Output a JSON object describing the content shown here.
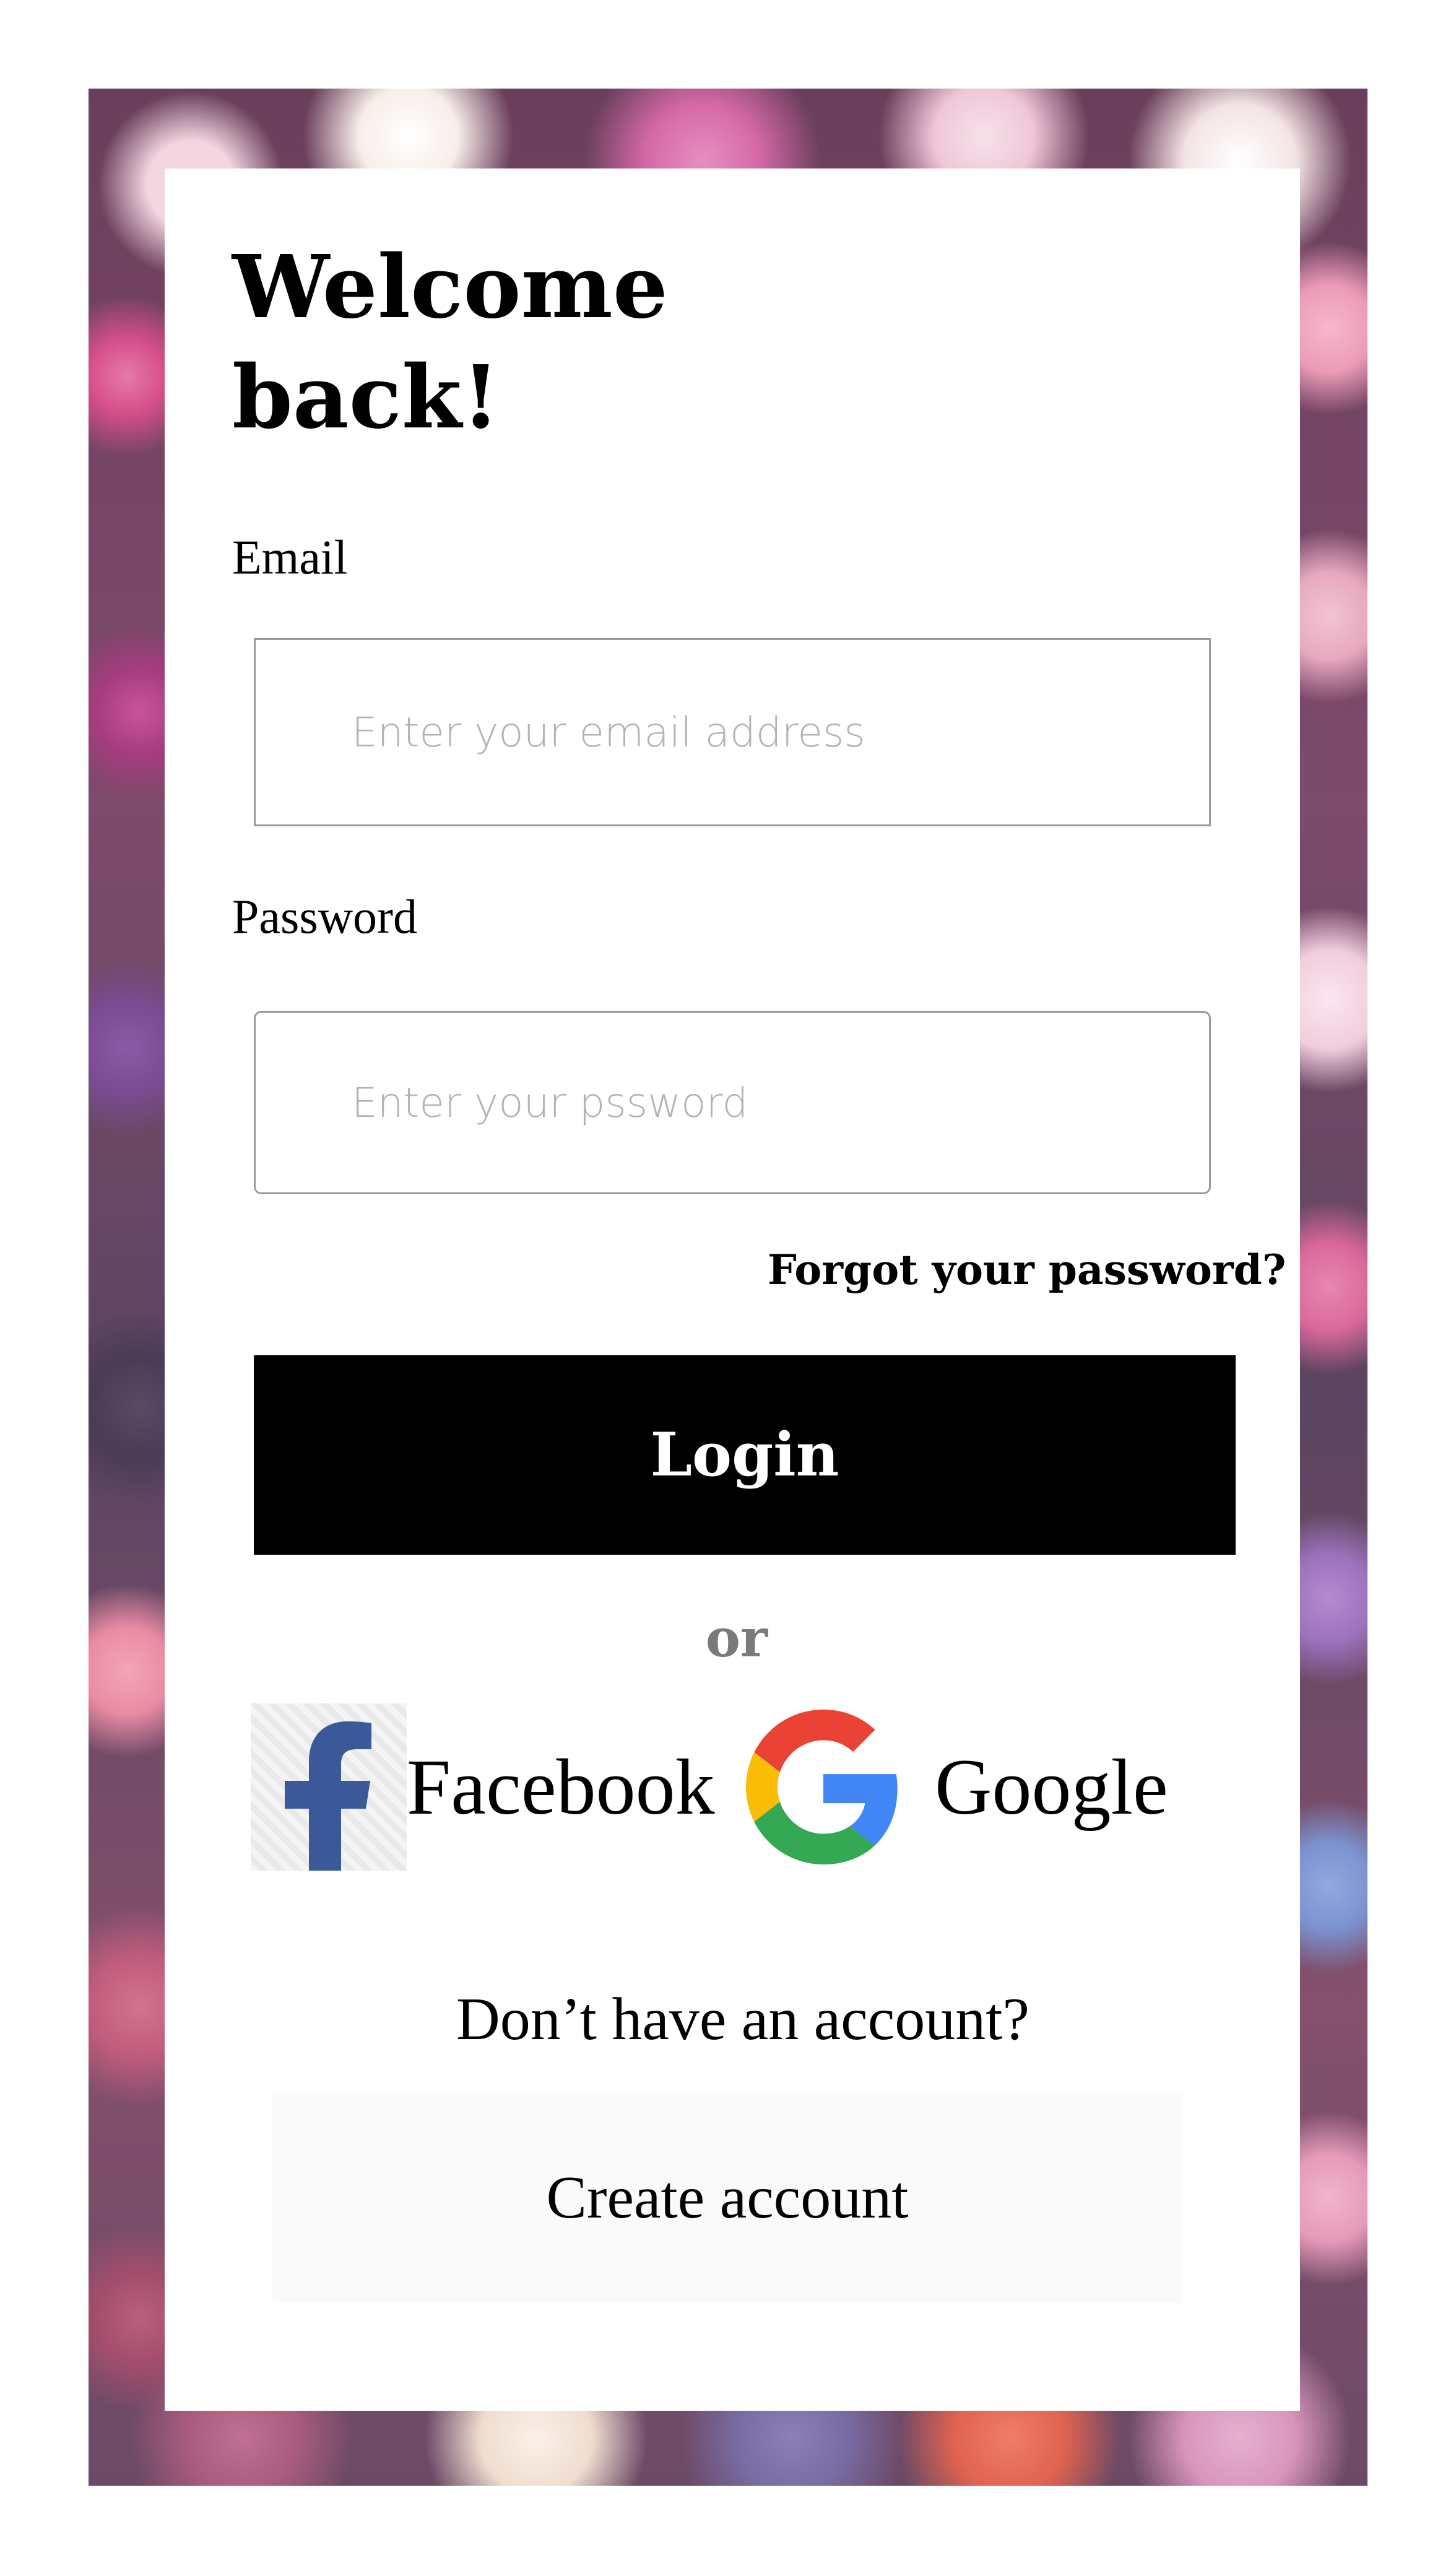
{
  "colors": {
    "primary_button_bg": "#000000",
    "primary_button_text": "#ffffff",
    "muted_text": "#7a7a7a",
    "placeholder_text": "#b3b3b3",
    "facebook_blue": "#3b5998",
    "google_red": "#ea4335",
    "google_yellow": "#fbbc05",
    "google_green": "#34a853",
    "google_blue": "#4285f4"
  },
  "header": {
    "title": "Welcome back!"
  },
  "form": {
    "email_label": "Email",
    "email_placeholder": "Enter your email address",
    "email_value": "",
    "password_label": "Password",
    "password_placeholder": "Enter your pssword",
    "password_value": "",
    "forgot_link": "Forgot your password?",
    "login_label": "Login"
  },
  "divider": {
    "text": "or"
  },
  "social": {
    "facebook": {
      "label": "Facebook",
      "icon": "facebook-icon"
    },
    "google": {
      "label": "Google",
      "icon": "google-icon"
    }
  },
  "signup": {
    "prompt": "Don’t have an account?",
    "button_label": "Create account"
  }
}
